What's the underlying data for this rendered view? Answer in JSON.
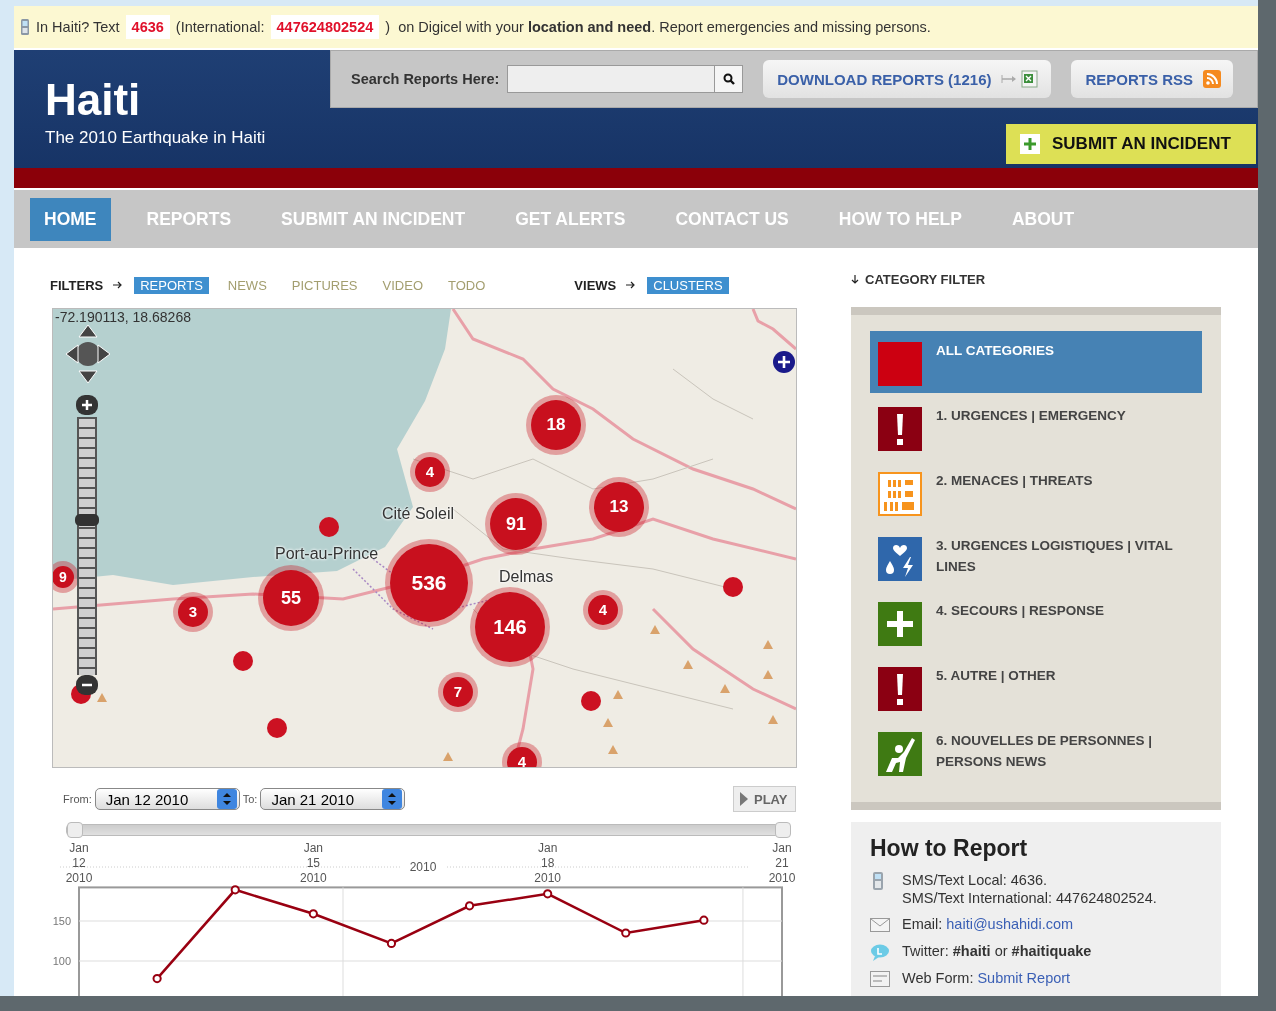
{
  "notice": {
    "lead": "In Haiti? Text",
    "local_number": "4636",
    "intl_label": "(International:",
    "intl_number": "447624802524",
    "rest": ")  on Digicel with your **location and need**. Report emergencies and missing persons."
  },
  "header": {
    "title": "Haiti",
    "subtitle": "The 2010 Earthquake in Haiti",
    "search_label": "Search Reports Here:",
    "download": "DOWNLOAD REPORTS (1216)",
    "rss": "REPORTS RSS",
    "submit": "SUBMIT AN INCIDENT"
  },
  "nav": [
    {
      "label": "HOME",
      "selected": true
    },
    {
      "label": "REPORTS",
      "selected": false
    },
    {
      "label": "SUBMIT AN INCIDENT",
      "selected": false
    },
    {
      "label": "GET ALERTS",
      "selected": false
    },
    {
      "label": "CONTACT US",
      "selected": false
    },
    {
      "label": "HOW TO HELP",
      "selected": false
    },
    {
      "label": "ABOUT",
      "selected": false
    }
  ],
  "filters": {
    "label": "FILTERS",
    "items": [
      {
        "label": "REPORTS",
        "selected": true
      },
      {
        "label": "NEWS",
        "selected": false
      },
      {
        "label": "PICTURES",
        "selected": false
      },
      {
        "label": "VIDEO",
        "selected": false
      },
      {
        "label": "TODO",
        "selected": false
      }
    ]
  },
  "views": {
    "label": "VIEWS",
    "items": [
      {
        "label": "CLUSTERS",
        "selected": true
      }
    ]
  },
  "map": {
    "coordinates": "-72.190113, 18.68268",
    "place_labels": [
      "Cité Soleil",
      "Port-au-Prince",
      "Delmas"
    ],
    "clusters": [
      "18",
      "4",
      "91",
      "13",
      "9",
      "3",
      "55",
      "536",
      "146",
      "4",
      "7",
      "4"
    ],
    "zoom": {
      "level": 0.6
    }
  },
  "timeline": {
    "from_label": "From:",
    "from": "Jan 12 2010",
    "to_label": "To:",
    "to": "Jan 21 2010",
    "play": "PLAY",
    "range_label": "2010",
    "range_handles": [
      {
        "level": 0
      },
      {
        "level": 1
      }
    ],
    "chart_data": {
      "type": "line",
      "categories": [
        "Jan 12 2010",
        null,
        null,
        "Jan 15 2010",
        null,
        null,
        "Jan 18 2010",
        null,
        null,
        "Jan 21 2010"
      ],
      "ylim": [
        55,
        192
      ],
      "yticks": [
        100,
        150
      ],
      "series": [
        {
          "color": "#990011",
          "marker": "circle",
          "values": [
            null,
            78,
            189,
            159,
            122,
            169,
            184,
            135,
            151,
            null
          ]
        }
      ]
    }
  },
  "category_filter": {
    "title": "CATEGORY FILTER",
    "items": [
      {
        "label": "ALL CATEGORIES",
        "kind": "square",
        "color": "#cc0011",
        "selected": true
      },
      {
        "label": "1. URGENCES | EMERGENCY",
        "kind": "alert",
        "color": "#8b0012",
        "selected": false
      },
      {
        "label": "2. MENACES | THREATS",
        "kind": "buildings",
        "color": "#f7941d",
        "selected": false
      },
      {
        "label": "3. URGENCES LOGISTIQUES | VITAL LINES",
        "kind": "lifelines",
        "color": "#2f67ab",
        "selected": false
      },
      {
        "label": "4. SECOURS | RESPONSE",
        "kind": "cross",
        "color": "#3f7a12",
        "selected": false
      },
      {
        "label": "5. AUTRE | OTHER",
        "kind": "alert",
        "color": "#8b0012",
        "selected": false
      },
      {
        "label": "6. NOUVELLES DE PERSONNES | PERSONS NEWS",
        "kind": "person",
        "color": "#3f7a13",
        "selected": false
      }
    ]
  },
  "how_to_report": {
    "title": "How to Report",
    "items": [
      {
        "kind": "sms",
        "lines": [
          "SMS/Text Local: 4636.",
          "SMS/Text International: 447624802524."
        ]
      },
      {
        "kind": "email",
        "label": "Email:",
        "link": "haiti@ushahidi.com"
      },
      {
        "kind": "twitter",
        "text": "Twitter: **#haiti** or **#haitiquake**"
      },
      {
        "kind": "webform",
        "label": "Web Form:",
        "link": "Submit Report"
      }
    ]
  }
}
